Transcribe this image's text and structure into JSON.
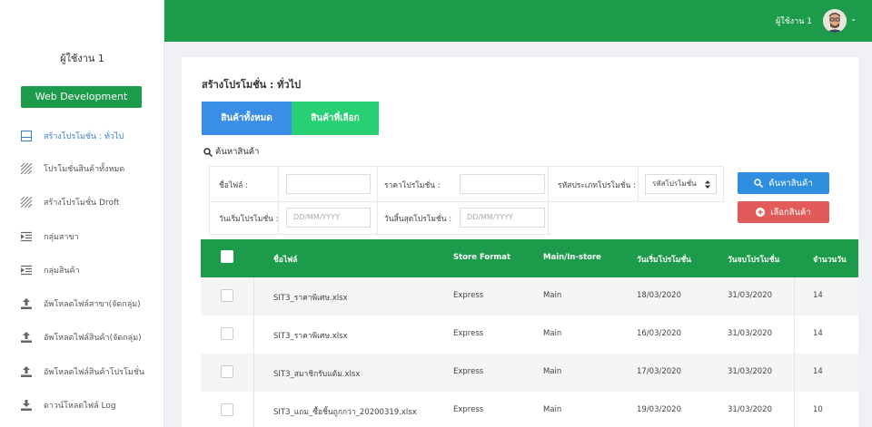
{
  "sidebar": {
    "user_name": "ผู้ใช้งาน 1",
    "workspace_button": "Web Development",
    "items": [
      {
        "label": "สร้างโปรโมชั่น : ทั่วไป",
        "icon": "layout-icon",
        "active": true
      },
      {
        "label": "โปรโมชั่นสินค้าทั้งหมด",
        "icon": "hatch-icon",
        "active": false
      },
      {
        "label": "สร้างโปรโมชั่น Droft",
        "icon": "hatch-icon",
        "active": false
      },
      {
        "label": "กลุ่มสาขา",
        "icon": "list-indent-icon",
        "active": false
      },
      {
        "label": "กลุ่มสินค้า",
        "icon": "list-indent-icon",
        "active": false
      },
      {
        "label": "อัพโหลดไฟล์สาขา(จัดกลุ่ม)",
        "icon": "upload-icon",
        "active": false
      },
      {
        "label": "อัพโหลดไฟล์สินค้า(จัดกลุ่ม)",
        "icon": "upload-icon",
        "active": false
      },
      {
        "label": "อัพโหลดไฟล์สินค้าโปรโมชั่น",
        "icon": "upload-icon",
        "active": false
      },
      {
        "label": "ดาวน์โหลดไฟล์ Log",
        "icon": "download-icon",
        "active": false
      }
    ]
  },
  "topbar": {
    "user_name": "ผู้ใช้งาน 1",
    "caret": "⌄"
  },
  "page": {
    "title": "สร้างโปรโมชั่น : ทั่วไป",
    "tabs": [
      "สินค้าทั้งหมด",
      "สินค้าที่เลือก"
    ],
    "search_heading": "ค้นหาสินค้า"
  },
  "form": {
    "file_name_label": "ชื่อไฟล์ :",
    "file_name_value": "",
    "promo_price_label": "ราคาโปรโมชั่น :",
    "promo_price_value": "",
    "promo_type_label": "รหัสประเภทโปรโมชั่น :",
    "promo_type_selected": "รหัสโปรโมชั่น",
    "start_date_label": "วันเริ่มโปรโมชั่น :",
    "start_date_placeholder": "DD/MM/YYYY",
    "end_date_label": "วันสิ้นสุดโปรโมชั่น :",
    "end_date_placeholder": "DD/MM/YYYY"
  },
  "actions": {
    "search_button": "ค้นหาสินค้า",
    "select_button": "เลือกสินค้า"
  },
  "table": {
    "columns": [
      "ชื่อไฟล์",
      "Store Format",
      "Main/In-store",
      "วันเริ่มโปรโมชั่น",
      "วันจบโปรโมชั่น",
      "จำนวนวัน"
    ],
    "rows": [
      {
        "file": "SIT3_ราคาพิเศษ.xlsx",
        "format": "Express",
        "main": "Main",
        "start": "18/03/2020",
        "end": "31/03/2020",
        "days": "14"
      },
      {
        "file": "SIT3_ราคาพิเศษ.xlsx",
        "format": "Express",
        "main": "Main",
        "start": "16/03/2020",
        "end": "31/03/2020",
        "days": "14"
      },
      {
        "file": "SIT3_สมาชิกรับแต้ม.xlsx",
        "format": "Express",
        "main": "Main",
        "start": "17/03/2020",
        "end": "31/03/2020",
        "days": "14"
      },
      {
        "file": "SIT3_แถม_ซื้อชิ้นถูกกว่า_20200319.xlsx",
        "format": "Express",
        "main": "Main",
        "start": "19/03/2020",
        "end": "31/03/2020",
        "days": "10"
      }
    ]
  },
  "colors": {
    "green": "#1c9b4b",
    "blue": "#3a8ee6",
    "light_green": "#27d072",
    "red": "#e25b5b"
  }
}
